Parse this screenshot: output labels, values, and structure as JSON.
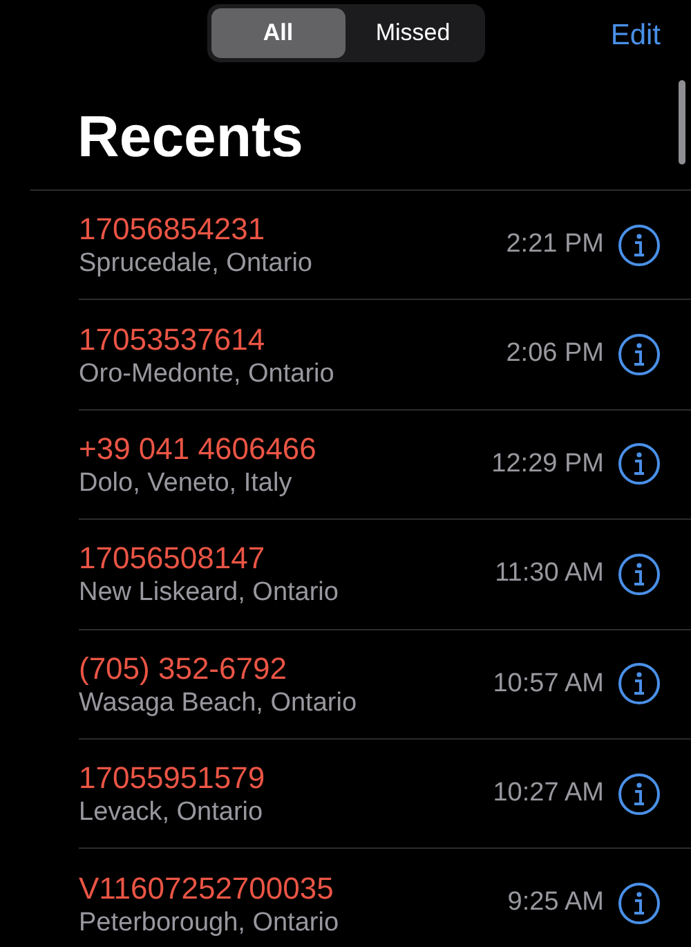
{
  "segments": [
    {
      "label": "All",
      "selected": true
    },
    {
      "label": "Missed",
      "selected": false
    }
  ],
  "edit": "Edit",
  "title": "Recents",
  "calls": [
    {
      "number": "17056854231",
      "location": "Sprucedale, Ontario",
      "time": "2:21 PM",
      "missed": true
    },
    {
      "number": "17053537614",
      "location": "Oro-Medonte, Ontario",
      "time": "2:06 PM",
      "missed": true
    },
    {
      "number": "+39 041 4606466",
      "location": "Dolo, Veneto, Italy",
      "time": "12:29 PM",
      "missed": true
    },
    {
      "number": "17056508147",
      "location": "New Liskeard, Ontario",
      "time": "11:30 AM",
      "missed": true
    },
    {
      "number": "(705) 352-6792",
      "location": "Wasaga Beach, Ontario",
      "time": "10:57 AM",
      "missed": true
    },
    {
      "number": "17055951579",
      "location": "Levack, Ontario",
      "time": "10:27 AM",
      "missed": true
    },
    {
      "number": "V11607252700035",
      "location": "Peterborough, Ontario",
      "time": "9:25 AM",
      "missed": true
    }
  ]
}
